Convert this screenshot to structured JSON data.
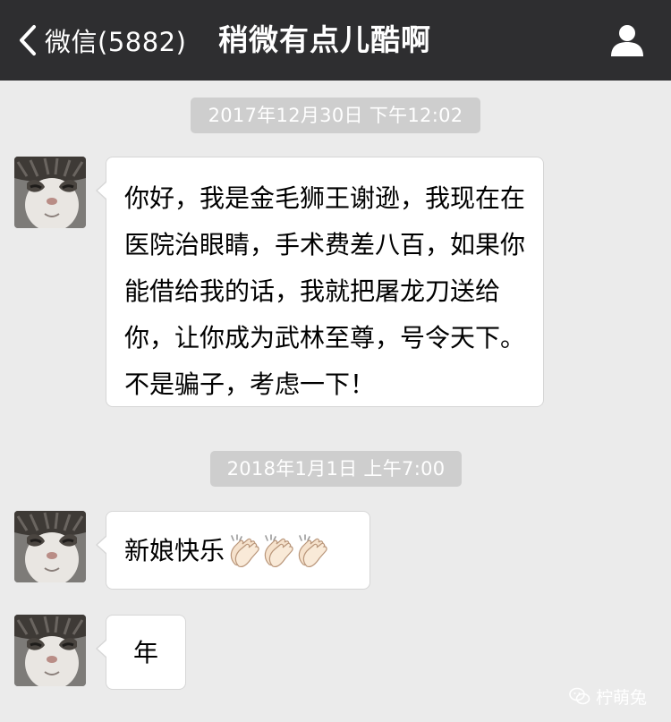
{
  "navbar": {
    "back_label": "微信(5882)",
    "title": "稍微有点儿酷啊",
    "back_icon": "chevron-left-icon",
    "profile_icon": "person-icon"
  },
  "messages": [
    {
      "timestamp": "2017年12月30日 下午12:02",
      "text": "你好，我是金毛狮王谢逊，我现在在医院治眼睛，手术费差八百，如果你能借给我的话，我就把屠龙刀送给你，让你成为武林至尊，号令天下。不是骗子，考虑一下！"
    },
    {
      "timestamp": "2018年1月1日 上午7:00",
      "text": "新娘快乐",
      "emoji": [
        "clapping-hands",
        "clapping-hands",
        "clapping-hands"
      ]
    },
    {
      "text": "年"
    }
  ],
  "watermark": {
    "text": "柠萌兔",
    "icon": "wechat-icon"
  },
  "colors": {
    "navbar_bg": "#2e2e30",
    "chat_bg": "#ebebeb",
    "bubble_bg": "#ffffff",
    "timestamp_bg": "#cecece"
  }
}
